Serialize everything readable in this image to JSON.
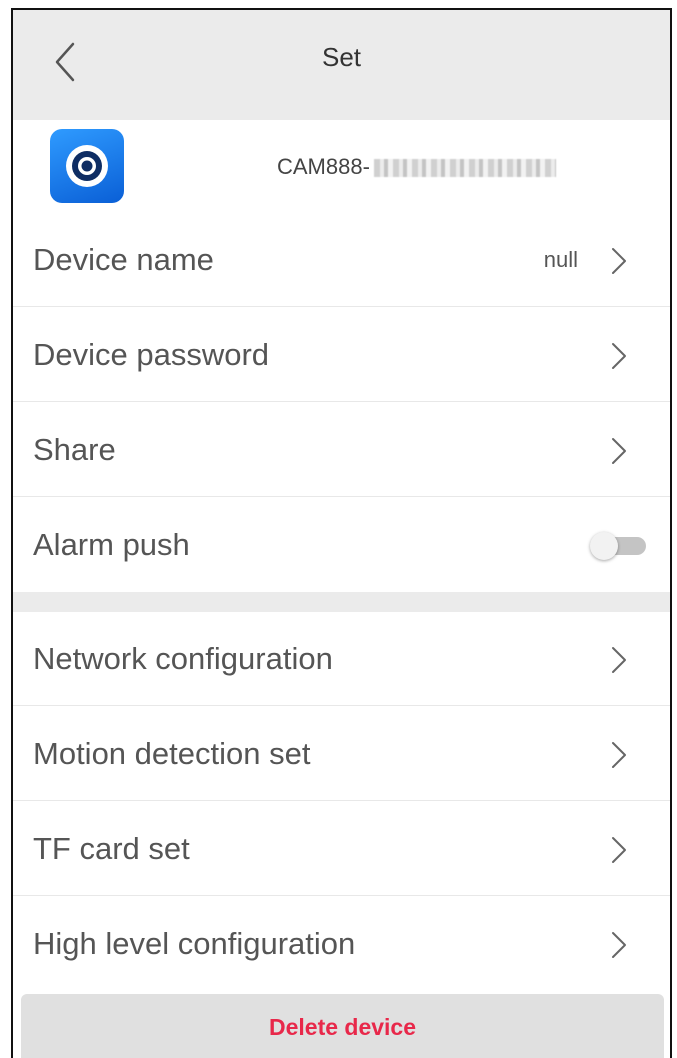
{
  "header": {
    "title": "Set",
    "back_icon": "chevron-left-icon"
  },
  "device": {
    "app_icon": "camera-eye-icon",
    "id_prefix": "CAM888-",
    "id_obscured": true
  },
  "settings_group_1": [
    {
      "label": "Device name",
      "value": "null",
      "control": "chevron"
    },
    {
      "label": "Device password",
      "control": "chevron"
    },
    {
      "label": "Share",
      "control": "chevron"
    },
    {
      "label": "Alarm push",
      "control": "toggle",
      "toggle_on": false
    }
  ],
  "settings_group_2": [
    {
      "label": "Network configuration",
      "control": "chevron"
    },
    {
      "label": "Motion detection set",
      "control": "chevron"
    },
    {
      "label": "TF card set",
      "control": "chevron"
    },
    {
      "label": "High level configuration",
      "control": "chevron"
    }
  ],
  "footer": {
    "delete_label": "Delete device"
  },
  "colors": {
    "header_bg": "#ebebeb",
    "delete_text": "#e8284a",
    "icon_blue": "#1a78f0"
  }
}
